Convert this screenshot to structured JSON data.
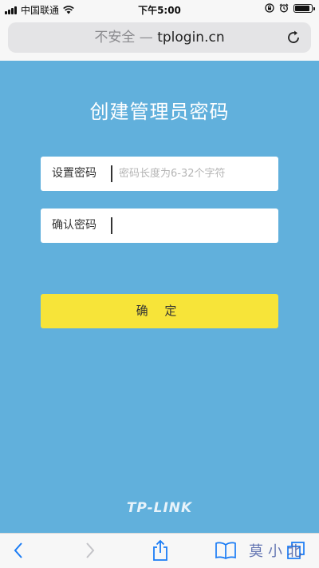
{
  "status_bar": {
    "carrier": "中国联通",
    "time": "下午5:00",
    "battery_level": 0.9
  },
  "browser": {
    "insecure_label": "不安全",
    "separator": "—",
    "domain": "tplogin.cn"
  },
  "page": {
    "title": "创建管理员密码",
    "password_label": "设置密码",
    "password_placeholder": "密码长度为6-32个字符",
    "confirm_label": "确认密码",
    "confirm_button": "确 定",
    "logo_text": "TP-LINK"
  },
  "watermark": "莫小北",
  "colors": {
    "page_background": "#61b0dc",
    "button_yellow": "#f7e439",
    "toolbar_icon": "#1a7cf5"
  },
  "icons": [
    "signal-icon",
    "wifi-icon",
    "lock-rotation-icon",
    "alarm-icon",
    "battery-icon",
    "reload-icon",
    "back-icon",
    "forward-icon",
    "share-icon",
    "bookmarks-icon",
    "tabs-icon"
  ]
}
